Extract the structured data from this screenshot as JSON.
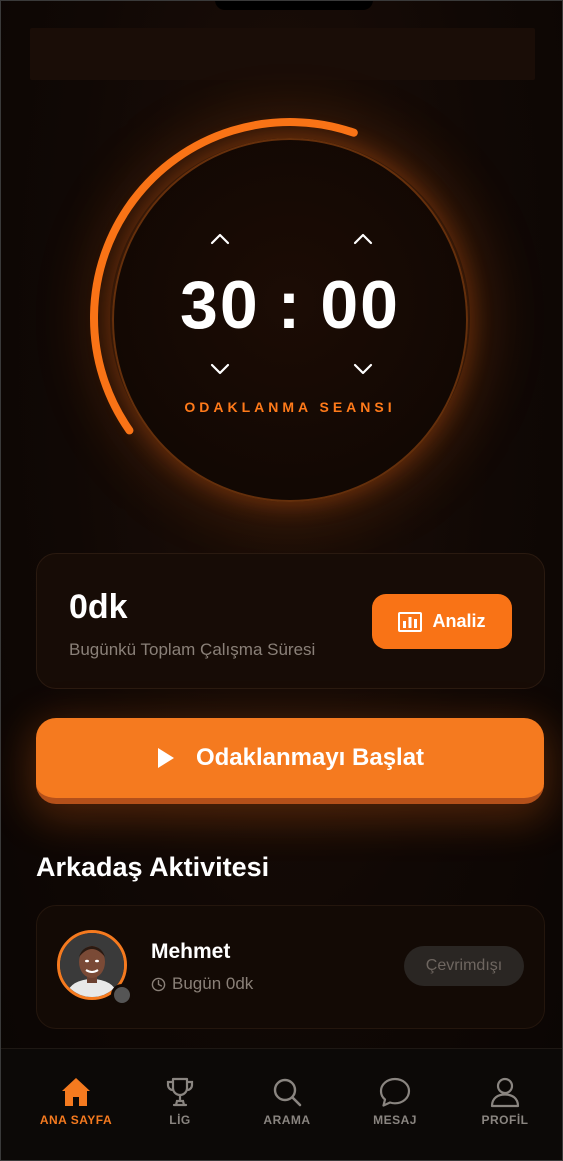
{
  "timer": {
    "minutes": "30",
    "colon": ":",
    "seconds": "00",
    "session_label": "ODAKLANMA SEANSI",
    "progress_fraction": 0.4
  },
  "stats": {
    "value": "0dk",
    "caption": "Bugünkü Toplam Çalışma Süresi",
    "analyze_label": "Analiz"
  },
  "start_button": {
    "label": "Odaklanmayı Başlat"
  },
  "friends": {
    "section_title": "Arkadaş Aktivitesi",
    "items": [
      {
        "name": "Mehmet",
        "activity": "Bugün 0dk",
        "status": "Çevrimdışı"
      }
    ]
  },
  "nav": {
    "items": [
      {
        "label": "ANA SAYFA",
        "icon": "home-icon",
        "active": true
      },
      {
        "label": "LİG",
        "icon": "trophy-icon",
        "active": false
      },
      {
        "label": "ARAMA",
        "icon": "search-icon",
        "active": false
      },
      {
        "label": "MESAJ",
        "icon": "message-icon",
        "active": false
      },
      {
        "label": "PROFİL",
        "icon": "profile-icon",
        "active": false
      }
    ]
  },
  "colors": {
    "accent": "#f97316",
    "background": "#0b0604",
    "card": "#170c06",
    "muted_text": "#8a8078",
    "inactive_nav": "#8a8580"
  }
}
